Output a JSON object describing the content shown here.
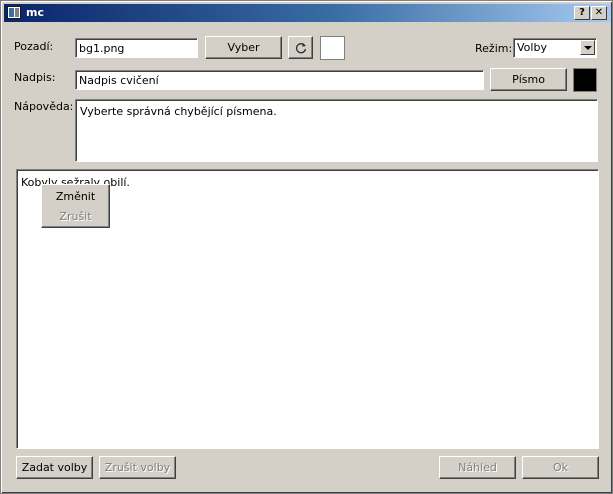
{
  "window": {
    "title": "mc",
    "help_button": "?",
    "close_button": "✕"
  },
  "background_row": {
    "label": "Pozadí:",
    "value": "bg1.png",
    "choose_button": "Vyber",
    "refresh_icon": "refresh-icon",
    "swatch_color": "#ffffff"
  },
  "mode": {
    "label": "Režim:",
    "selected": "Volby"
  },
  "title_row": {
    "label": "Nadpis:",
    "value": "Nadpis cvičení",
    "font_button": "Písmo",
    "color_swatch": "#000000"
  },
  "hint_row": {
    "label": "Nápověda:",
    "value": "Vyberte správná chybějící písmena."
  },
  "editor": {
    "text": "Kobyly sežraly obilí."
  },
  "context_menu": {
    "items": [
      {
        "label": "Změnit",
        "enabled": true
      },
      {
        "label": "Zrušit",
        "enabled": false
      }
    ]
  },
  "footer": {
    "set_options": "Zadat volby",
    "cancel_options": "Zrušit volby",
    "preview": "Náhled",
    "ok": "Ok"
  }
}
